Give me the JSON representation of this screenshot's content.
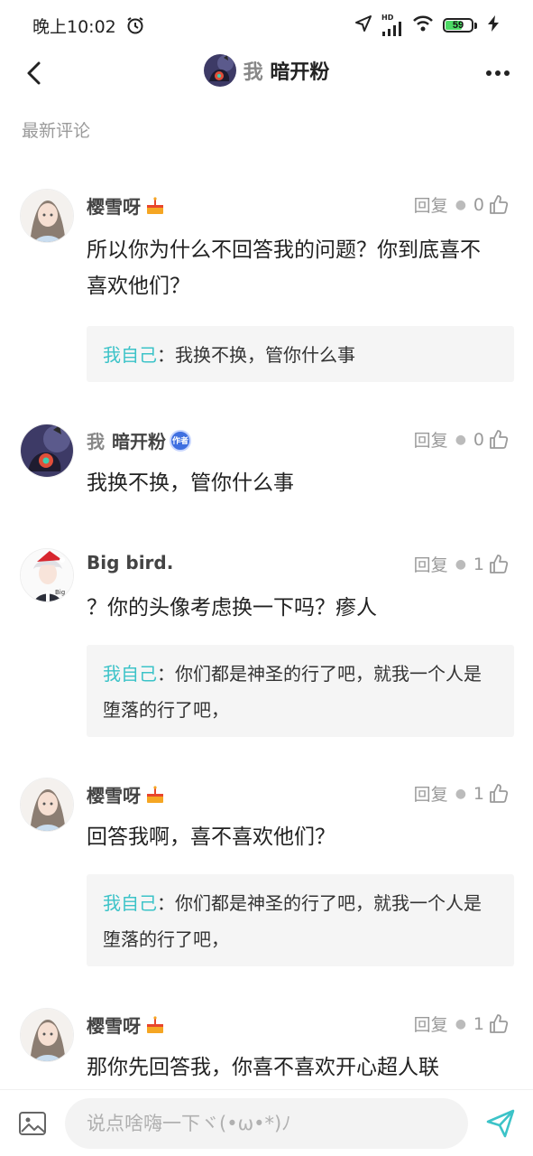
{
  "status_bar": {
    "time": "晚上10:02",
    "network": "HD",
    "battery": "59",
    "battery_level": 0.59
  },
  "header": {
    "title_prefix": "我",
    "title_name": "暗开粉"
  },
  "section": {
    "label": "最新评论"
  },
  "comments": [
    {
      "name": "樱雪呀",
      "reply_label": "回复",
      "likes": "0",
      "text": "所以你为什么不回答我的问题？你到底喜不喜欢他们？",
      "quote_who": "我自己",
      "quote_sep": "：",
      "quote_text": "我换不换，管你什么事"
    },
    {
      "name_prefix": "我",
      "name": "暗开粉",
      "badge": "作者",
      "reply_label": "回复",
      "likes": "0",
      "text": "我换不换，管你什么事"
    },
    {
      "name": "Big bird.",
      "reply_label": "回复",
      "likes": "1",
      "text": "？你的头像考虑换一下吗？瘆人",
      "quote_who": "我自己",
      "quote_sep": "：",
      "quote_text": "你们都是神圣的行了吧，就我一个人是堕落的行了吧，"
    },
    {
      "name": "樱雪呀",
      "reply_label": "回复",
      "likes": "1",
      "text": "回答我啊，喜不喜欢他们？",
      "quote_who": "我自己",
      "quote_sep": "：",
      "quote_text": "你们都是神圣的行了吧，就我一个人是堕落的行了吧，"
    },
    {
      "name": "樱雪呀",
      "reply_label": "回复",
      "likes": "1",
      "text": "那你先回答我，你喜不喜欢开心超人联"
    }
  ],
  "composer": {
    "placeholder": "说点啥嗨一下ヾ(•ω•*)ﾉ"
  },
  "colors": {
    "accent": "#3cc3c8",
    "badge": "#3f6fe0",
    "battery": "#4cd964"
  },
  "icons": [
    "alarm-icon",
    "location-icon",
    "signal-icon",
    "wifi-icon",
    "charging-icon",
    "back-icon",
    "more-icon",
    "cake-icon",
    "thumbs-up-icon",
    "image-icon",
    "send-icon"
  ]
}
